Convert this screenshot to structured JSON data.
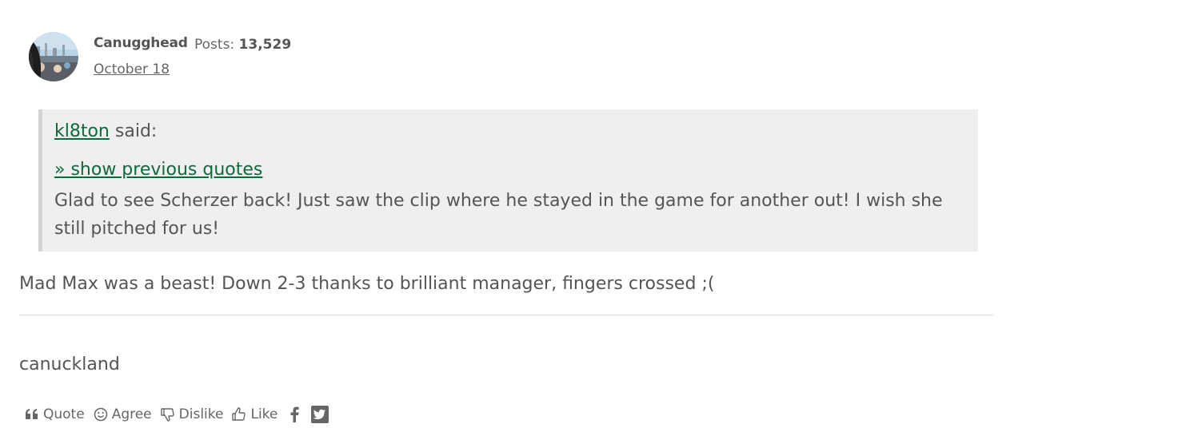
{
  "comment": {
    "author": {
      "name": "Canugghead",
      "posts_label": "Posts:",
      "posts_count": "13,529",
      "date": "October 18"
    },
    "quote": {
      "user": "kl8ton",
      "said": " said:",
      "show_previous": "» show previous quotes",
      "text": "Glad to see Scherzer back!  Just saw the clip where he stayed in the game for another out! I wish she still pitched for us!"
    },
    "body": "Mad Max was a beast! Down 2-3 thanks to brilliant manager, fingers crossed ;(",
    "signature": "canuckland",
    "reactions": [
      {
        "label": "Quote",
        "icon": "quote-icon"
      },
      {
        "label": "Agree",
        "icon": "smiley-icon"
      },
      {
        "label": "Dislike",
        "icon": "thumbs-down-icon"
      },
      {
        "label": "Like",
        "icon": "thumbs-up-icon"
      }
    ],
    "share": [
      {
        "icon": "facebook-icon"
      },
      {
        "icon": "twitter-icon"
      }
    ]
  }
}
